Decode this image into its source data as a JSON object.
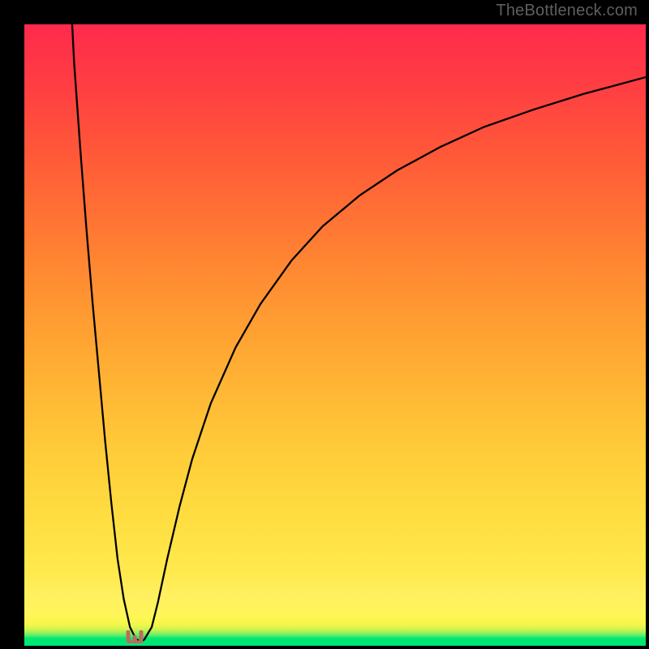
{
  "watermark": "TheBottleneck.com",
  "chart_data": {
    "type": "line",
    "title": "",
    "xlabel": "",
    "ylabel": "",
    "xlim": [
      0,
      100
    ],
    "ylim": [
      0,
      100
    ],
    "series": [
      {
        "name": "curve",
        "x": [
          7.7,
          8,
          9,
          10,
          11,
          12,
          13,
          14,
          15,
          16,
          17,
          18,
          18.5,
          19.0,
          19.3,
          20.5,
          21.5,
          23,
          25,
          27,
          30,
          34,
          38,
          43,
          48,
          54,
          60,
          67,
          74,
          82,
          90,
          100
        ],
        "y": [
          100,
          94,
          80,
          67,
          55,
          44,
          33,
          23,
          14,
          7.5,
          3.0,
          1.0,
          0.8,
          0.8,
          1.0,
          3.0,
          7.0,
          14,
          22.5,
          30,
          39,
          48,
          55,
          62,
          67.5,
          72.5,
          76.5,
          80.3,
          83.5,
          86.3,
          88.8,
          91.5
        ]
      }
    ],
    "marker": {
      "x": 18.7,
      "y": 0.8,
      "shape": "u",
      "color": "#c06a5e"
    },
    "background_gradient": {
      "bottom_color": "#00e873",
      "top_color": "#ff2a4c"
    }
  }
}
